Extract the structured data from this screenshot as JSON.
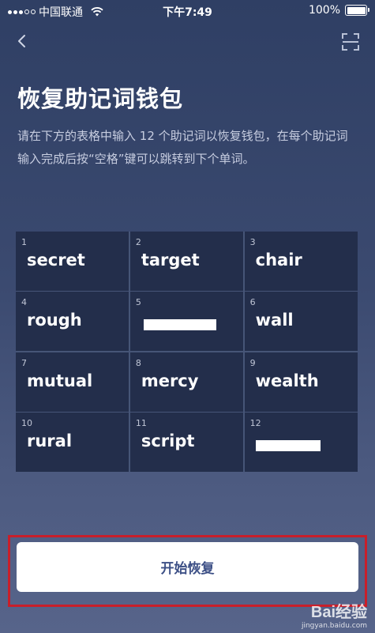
{
  "status_bar": {
    "carrier": "中国联通",
    "time": "下午7:49",
    "battery": "100%"
  },
  "header": {
    "back_icon": "chevron-left-icon",
    "scan_icon": "scan-frame-icon"
  },
  "title": "恢复助记词钱包",
  "description": "请在下方的表格中输入 12 个助记词以恢复钱包，在每个助记词输入完成后按“空格”键可以跳转到下个单词。",
  "words": [
    {
      "num": "1",
      "word": "secret"
    },
    {
      "num": "2",
      "word": "target"
    },
    {
      "num": "3",
      "word": "chair"
    },
    {
      "num": "4",
      "word": "rough"
    },
    {
      "num": "5",
      "word": ""
    },
    {
      "num": "6",
      "word": "wall"
    },
    {
      "num": "7",
      "word": "mutual"
    },
    {
      "num": "8",
      "word": "mercy"
    },
    {
      "num": "9",
      "word": "wealth"
    },
    {
      "num": "10",
      "word": "rural"
    },
    {
      "num": "11",
      "word": "script"
    },
    {
      "num": "12",
      "word": ""
    }
  ],
  "restore_button": "开始恢复",
  "watermark": {
    "logo": "Bai经验",
    "url": "jingyan.baidu.com"
  },
  "colors": {
    "background_top": "#2f3f64",
    "background_bottom": "#57648a",
    "cell_background": "#232e4b",
    "button_text": "#3d5086",
    "highlight_border": "#c81f2a"
  }
}
